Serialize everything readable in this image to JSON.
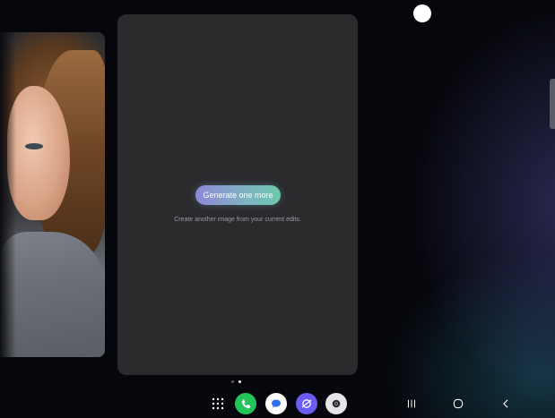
{
  "main_card": {
    "generate_button_label": "Generate one more",
    "generate_hint": "Create another image from your current edits."
  },
  "pagination": {
    "count": 2,
    "active_index": 1
  },
  "taskbar": {
    "apps": [
      {
        "name": "apps-grid-icon"
      },
      {
        "name": "phone-icon",
        "color": "#24c35a"
      },
      {
        "name": "messages-icon",
        "color": "#ffffff"
      },
      {
        "name": "internet-icon",
        "color": "#6a5cf0"
      },
      {
        "name": "camera-icon",
        "color": "#e6e6ea"
      }
    ],
    "nav": [
      "recent-apps-icon",
      "home-icon",
      "back-icon"
    ]
  },
  "colors": {
    "accent_gradient_start": "#8f88d8",
    "accent_gradient_end": "#6fc8ae",
    "card_background": "#2b2b2e"
  }
}
